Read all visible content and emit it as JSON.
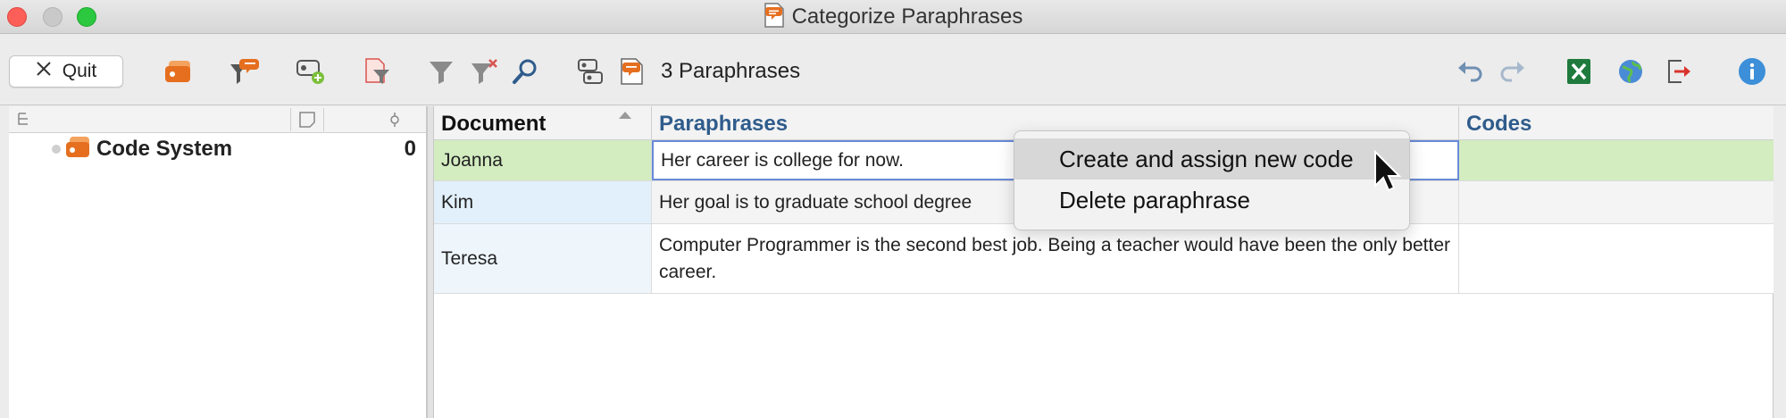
{
  "window": {
    "title": "Categorize Paraphrases"
  },
  "toolbar": {
    "quit_label": "Quit",
    "paraphrase_count": "3 Paraphrases",
    "icons": [
      "code-system-icon",
      "paraphrase-filter-icon",
      "new-code-icon",
      "document-filter-icon",
      "filter-icon",
      "clear-filter-icon",
      "search-icon",
      "code-toggle-icon",
      "paraphrase-icon",
      "undo-icon",
      "redo-icon",
      "excel-export-icon",
      "web-export-icon",
      "export-icon",
      "info-icon"
    ],
    "colors": {
      "accent_orange": "#e56f1f",
      "accent_blue": "#2f5c8c",
      "excel_green": "#1e7a3d"
    }
  },
  "code_system": {
    "label": "Code System",
    "count": "0"
  },
  "table": {
    "columns": [
      "Document",
      "Paraphrases",
      "Codes"
    ],
    "rows": [
      {
        "document": "Joanna",
        "paraphrase": "Her career is college for now.",
        "codes": ""
      },
      {
        "document": "Kim",
        "paraphrase": "Her goal is to graduate school degree",
        "codes": ""
      },
      {
        "document": "Teresa",
        "paraphrase": "Computer Programmer is the second best job. Being a teacher would have been the only better career.",
        "codes": ""
      }
    ]
  },
  "context_menu": {
    "items": [
      "Create and assign new code",
      "Delete paraphrase"
    ]
  }
}
